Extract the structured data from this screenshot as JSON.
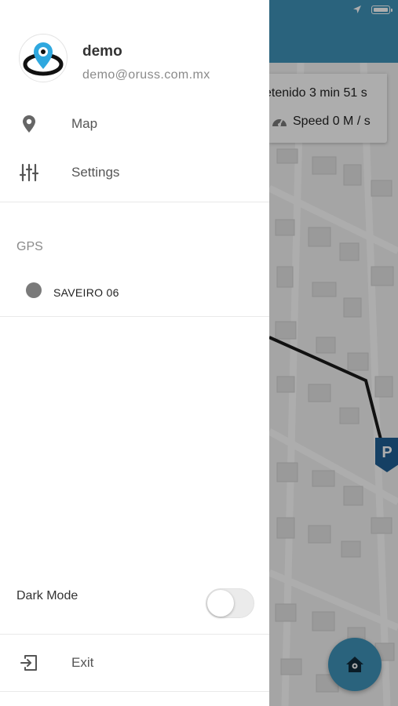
{
  "user": {
    "name": "demo",
    "email": "demo@oruss.com.mx",
    "avatar_icon": "eye-location-logo-icon"
  },
  "menu": [
    {
      "label": "Map",
      "icon": "map-pin-icon"
    },
    {
      "label": "Settings",
      "icon": "sliders-icon"
    }
  ],
  "gps_section": {
    "title": "GPS",
    "devices": [
      {
        "name": "SAVEIRO 06",
        "status_color": "#7a7a7a"
      }
    ]
  },
  "dark_mode": {
    "label": "Dark Mode",
    "enabled": false
  },
  "exit": {
    "label": "Exit",
    "icon": "exit-icon"
  },
  "map_info": {
    "stopped_text": "etenido 3 min 51 s",
    "speed_text": "Speed 0 M / s"
  },
  "map_marker": {
    "label": "P",
    "color": "#1f5f94"
  },
  "colors": {
    "accent": "#3f93b8",
    "overlay": "rgba(0,0,0,0.32)"
  }
}
